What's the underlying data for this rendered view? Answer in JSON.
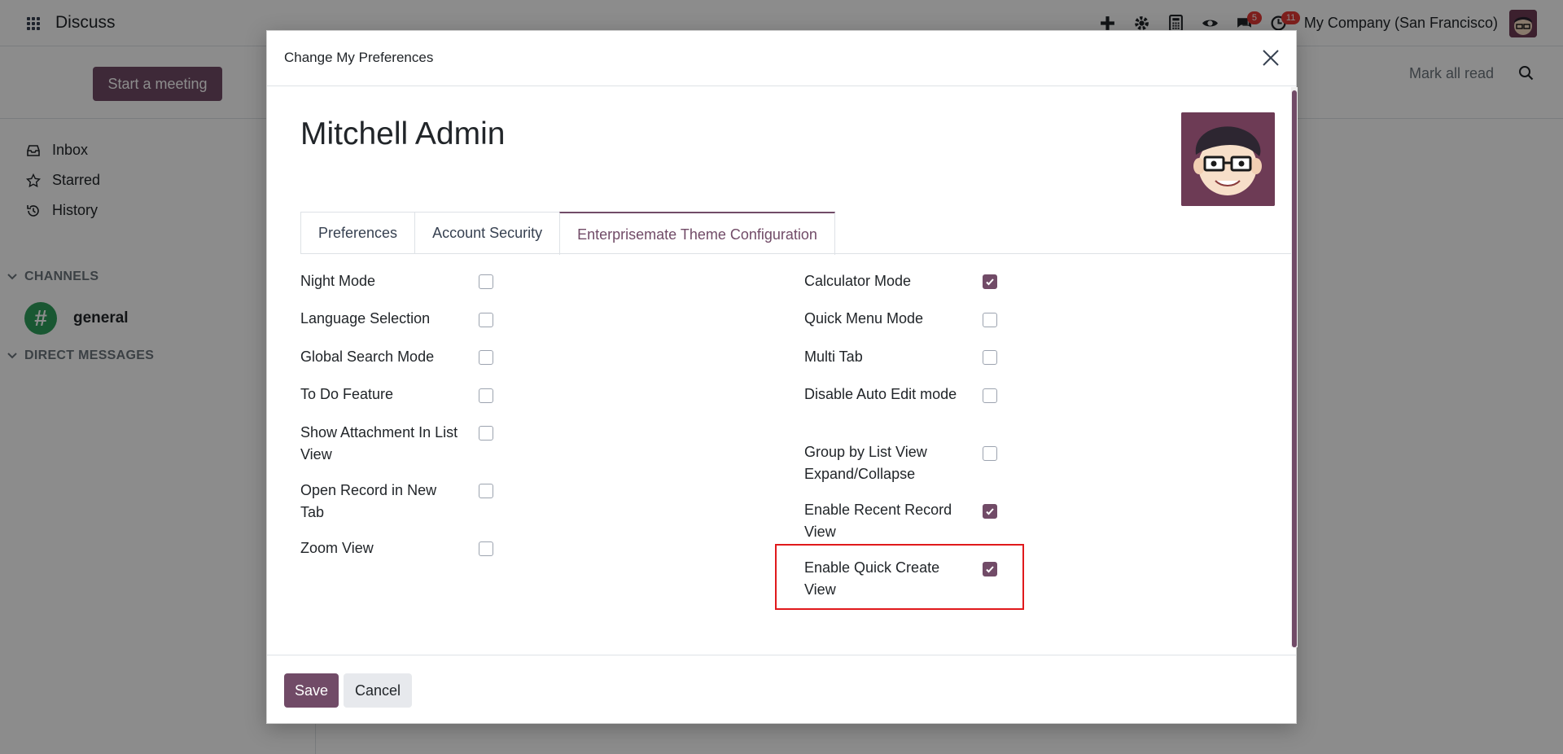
{
  "app": {
    "name": "Discuss",
    "company": "My Company (San Francisco)",
    "messages_badge": "5",
    "activities_badge": "11"
  },
  "control": {
    "start_meeting": "Start a meeting",
    "mark_all_read": "Mark all read"
  },
  "sidebar": {
    "items": [
      {
        "label": "Inbox",
        "icon": "inbox-icon"
      },
      {
        "label": "Starred",
        "icon": "star-icon"
      },
      {
        "label": "History",
        "icon": "history-icon"
      }
    ],
    "channels_heading": "CHANNELS",
    "channel_name": "general",
    "channel_avatar": "#",
    "direct_messages_heading": "DIRECT MESSAGES"
  },
  "modal": {
    "title": "Change My Preferences",
    "user_name": "Mitchell Admin",
    "tabs": [
      "Preferences",
      "Account Security",
      "Enterprisemate Theme Configuration"
    ],
    "active_tab": "Enterprisemate Theme Configuration",
    "left_fields": [
      {
        "label": "Night Mode",
        "checked": false
      },
      {
        "label": "Language Selection",
        "checked": false
      },
      {
        "label": "Global Search Mode",
        "checked": false
      },
      {
        "label": "To Do Feature",
        "checked": false
      },
      {
        "label": "Show Attachment In List View",
        "checked": false
      },
      {
        "label": "Open Record in New Tab",
        "checked": false
      },
      {
        "label": "Zoom View",
        "checked": false
      }
    ],
    "right_fields": [
      {
        "label": "Calculator Mode",
        "checked": true
      },
      {
        "label": "Quick Menu Mode",
        "checked": false
      },
      {
        "label": "Multi Tab",
        "checked": false
      },
      {
        "label": "Disable Auto Edit mode",
        "checked": false
      },
      {
        "label": "Group by List View Expand/Collapse",
        "checked": false
      },
      {
        "label": "Enable Recent Record View",
        "checked": true
      },
      {
        "label": "Enable Quick Create View",
        "checked": true
      }
    ],
    "save": "Save",
    "cancel": "Cancel"
  },
  "colors": {
    "brand": "#714b67",
    "highlight": "#e0191c"
  }
}
